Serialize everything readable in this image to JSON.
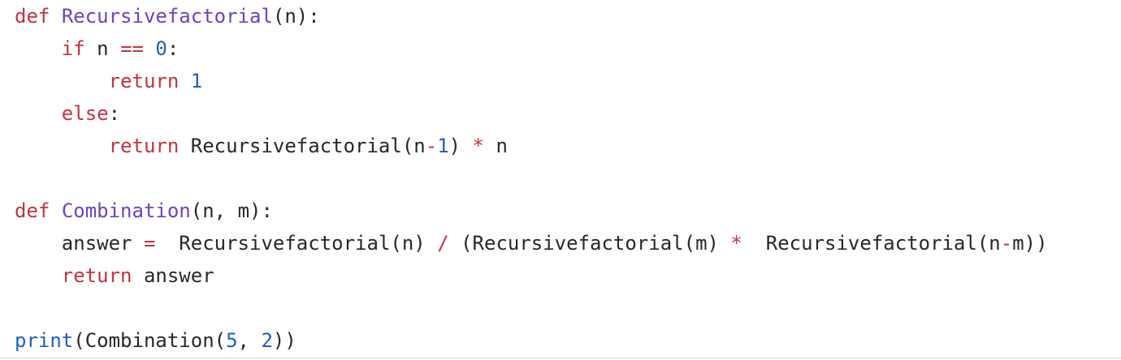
{
  "code": {
    "lines": [
      [
        {
          "t": "def",
          "c": "kw"
        },
        {
          "t": " ",
          "c": "plain"
        },
        {
          "t": "Recursivefactorial",
          "c": "fn"
        },
        {
          "t": "(n):",
          "c": "plain"
        }
      ],
      [
        {
          "t": "    ",
          "c": "plain"
        },
        {
          "t": "if",
          "c": "kw"
        },
        {
          "t": " n ",
          "c": "plain"
        },
        {
          "t": "==",
          "c": "op"
        },
        {
          "t": " ",
          "c": "plain"
        },
        {
          "t": "0",
          "c": "num"
        },
        {
          "t": ":",
          "c": "plain"
        }
      ],
      [
        {
          "t": "        ",
          "c": "plain"
        },
        {
          "t": "return",
          "c": "kw"
        },
        {
          "t": " ",
          "c": "plain"
        },
        {
          "t": "1",
          "c": "num"
        }
      ],
      [
        {
          "t": "    ",
          "c": "plain"
        },
        {
          "t": "else",
          "c": "kw"
        },
        {
          "t": ":",
          "c": "plain"
        }
      ],
      [
        {
          "t": "        ",
          "c": "plain"
        },
        {
          "t": "return",
          "c": "kw"
        },
        {
          "t": " Recursivefactorial(n",
          "c": "plain"
        },
        {
          "t": "-",
          "c": "op"
        },
        {
          "t": "1",
          "c": "num"
        },
        {
          "t": ") ",
          "c": "plain"
        },
        {
          "t": "*",
          "c": "op"
        },
        {
          "t": " n",
          "c": "plain"
        }
      ],
      [],
      [
        {
          "t": "def",
          "c": "kw"
        },
        {
          "t": " ",
          "c": "plain"
        },
        {
          "t": "Combination",
          "c": "fn"
        },
        {
          "t": "(n, m):",
          "c": "plain"
        }
      ],
      [
        {
          "t": "    answer ",
          "c": "plain"
        },
        {
          "t": "=",
          "c": "op"
        },
        {
          "t": "  Recursivefactorial(n) ",
          "c": "plain"
        },
        {
          "t": "/",
          "c": "op"
        },
        {
          "t": " (Recursivefactorial(m) ",
          "c": "plain"
        },
        {
          "t": "*",
          "c": "op"
        },
        {
          "t": "  Recursivefactorial(n",
          "c": "plain"
        },
        {
          "t": "-",
          "c": "op"
        },
        {
          "t": "m))",
          "c": "plain"
        }
      ],
      [
        {
          "t": "    ",
          "c": "plain"
        },
        {
          "t": "return",
          "c": "kw"
        },
        {
          "t": " answer",
          "c": "plain"
        }
      ],
      [],
      [
        {
          "t": "print",
          "c": "builtin"
        },
        {
          "t": "(Combination(",
          "c": "plain"
        },
        {
          "t": "5",
          "c": "num"
        },
        {
          "t": ", ",
          "c": "plain"
        },
        {
          "t": "2",
          "c": "num"
        },
        {
          "t": "))",
          "c": "plain"
        }
      ]
    ]
  },
  "colors": {
    "keyword": "#c4343f",
    "function_name": "#6f42c1",
    "number": "#1f5fbf",
    "builtin": "#1f5fbf",
    "text": "#24292e",
    "background": "#ffffff"
  }
}
